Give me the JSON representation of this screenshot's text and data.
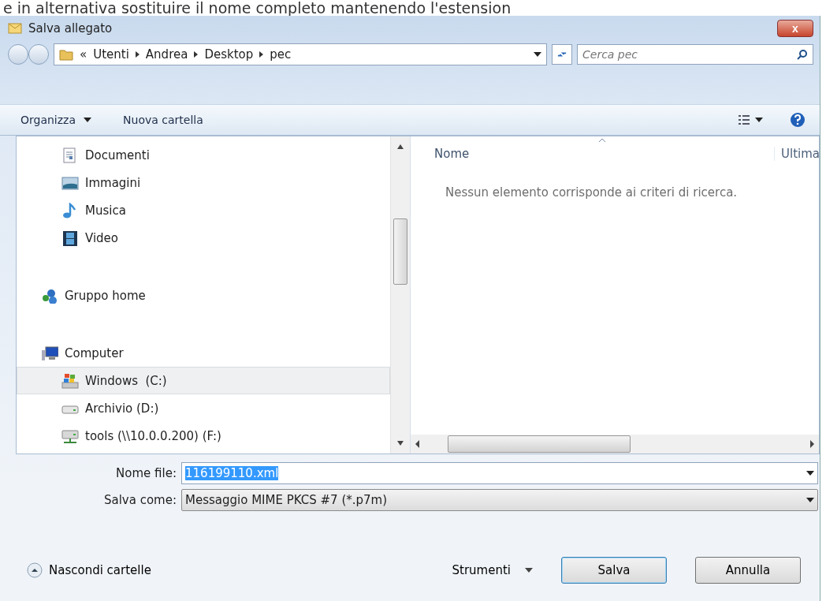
{
  "caption_above": "e in alternativa sostituire il nome completo mantenendo l'estension",
  "window": {
    "title": "Salva allegato",
    "close_label": "x"
  },
  "address": {
    "overflow": "«",
    "crumbs": [
      "Utenti",
      "Andrea",
      "Desktop",
      "pec"
    ],
    "search_placeholder": "Cerca pec"
  },
  "toolbar": {
    "organize": "Organizza",
    "new_folder": "Nuova cartella"
  },
  "nav": {
    "continued_children": [
      {
        "kind": "documents",
        "label": "Documenti",
        "selected": false
      },
      {
        "kind": "pictures",
        "label": "Immagini",
        "selected": false
      },
      {
        "kind": "music",
        "label": "Musica",
        "selected": false
      },
      {
        "kind": "video",
        "label": "Video",
        "selected": false
      }
    ],
    "items": [
      {
        "kind": "homegroup",
        "label": "Gruppo home",
        "selected": false
      },
      {
        "kind": "computer",
        "label": "Computer",
        "selected": false,
        "children": [
          {
            "kind": "system-drive",
            "label": "Windows  (C:)",
            "selected": true
          },
          {
            "kind": "drive",
            "label": "Archivio (D:)",
            "selected": false
          },
          {
            "kind": "network-drive",
            "label": "tools (\\\\10.0.0.200) (F:)",
            "selected": false
          }
        ]
      }
    ]
  },
  "file_list": {
    "columns": [
      {
        "label": "Nome",
        "sorted": true
      },
      {
        "label": "Ultima",
        "sorted": false
      }
    ],
    "empty_message": "Nessun elemento corrisponde ai criteri di ricerca."
  },
  "fields": [
    {
      "kind": "combo",
      "label": "Nome file:",
      "value": "116199110.xml",
      "value_selected": true
    },
    {
      "kind": "select",
      "label": "Salva come:",
      "value": "Messaggio MIME PKCS #7 (*.p7m)",
      "value_selected": false
    }
  ],
  "footer": {
    "hide_folders": "Nascondi cartelle",
    "tools": "Strumenti",
    "buttons": [
      {
        "label": "Salva",
        "default": true
      },
      {
        "label": "Annulla",
        "default": false
      }
    ]
  }
}
